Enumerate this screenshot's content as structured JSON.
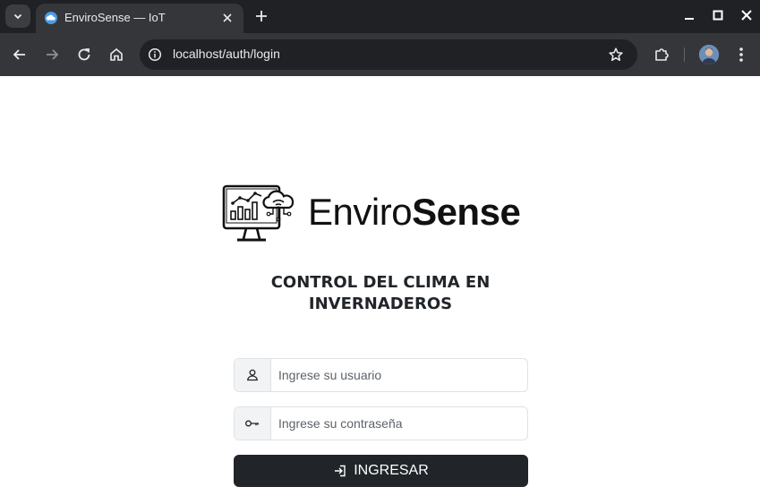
{
  "browser": {
    "tab_title": "EnviroSense — IoT",
    "url": "localhost/auth/login"
  },
  "brand": {
    "name_light": "Enviro",
    "name_bold": "Sense"
  },
  "login": {
    "subtitle_line1": "CONTROL DEL CLIMA EN",
    "subtitle_line2": "INVERNADEROS",
    "username_placeholder": "Ingrese su usuario",
    "password_placeholder": "Ingrese su contraseña",
    "submit_label": "INGRESAR"
  }
}
